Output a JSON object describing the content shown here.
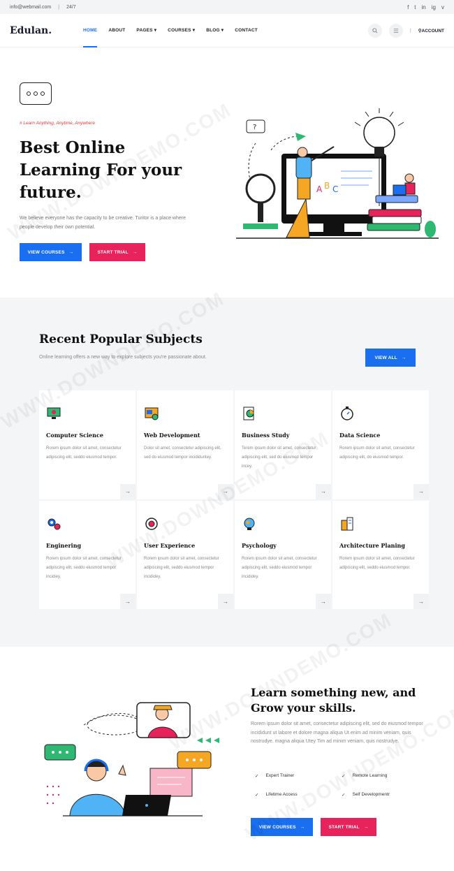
{
  "topbar": {
    "email": "info@webmail.com",
    "hours": "24/7",
    "social": [
      "f",
      "t",
      "in",
      "ig",
      "v"
    ]
  },
  "nav": {
    "logo": "Edulan.",
    "items": [
      "HOME",
      "ABOUT",
      "PAGES ▾",
      "COURSES ▾",
      "BLOG ▾",
      "CONTACT"
    ],
    "account": "ACCOUNT"
  },
  "hero": {
    "tagline": "# Learn Anything, Anytime, Anywhere",
    "title": "Best Online Learning For your future.",
    "desc": "We believe everyone has the capacity to be creative. Turitor is a place where people develop their own potential.",
    "btn_courses": "VIEW COURSES",
    "btn_trial": "START TRIAL"
  },
  "subjects": {
    "title": "Recent Popular Subjects",
    "subtitle": "Online learning offers a new way to explore subjects you're passionate about.",
    "view_all": "VIEW ALL",
    "cards": [
      {
        "title": "Computer Science",
        "desc": "Rorem ipsum dolor sit amet, consectetur adipiscing elit, seddo eiusmod tempor.",
        "icon": "monitor-icon"
      },
      {
        "title": "Web Development",
        "desc": "Dolor sit amet, consectetur adipiscing elit, sed do eiusmod tempor incididuntey.",
        "icon": "web-icon"
      },
      {
        "title": "Business Study",
        "desc": "Terem ipsum dolor sit amet, consectetur adipiscing elit, sed do eiusmod tempor incey.",
        "icon": "chart-icon"
      },
      {
        "title": "Data Science",
        "desc": "Rorem ipsum dolor sit amet, consectetur adipiscing elit, do eiusmod tempor.",
        "icon": "stopwatch-icon"
      },
      {
        "title": "Enginering",
        "desc": "Rorem ipsum dolor sit amet, consectetur adipiscing elit, seddo eiusmod tempor incidiey.",
        "icon": "gears-icon"
      },
      {
        "title": "User Experience",
        "desc": "Rorem ipsum dolor sit amet, consectetur adipiscing elit, seddo eiusmod tempor incididey.",
        "icon": "target-icon"
      },
      {
        "title": "Psychology",
        "desc": "Rorem ipsum dolor sit amet, consectetur adipiscing elit, seddo eiusmod tempor incididey.",
        "icon": "brain-icon"
      },
      {
        "title": "Architecture Planing",
        "desc": "Rorem ipsum dolor sit amet, consectetur adipiscing elit, seddo eiusmod tempor.",
        "icon": "building-icon"
      }
    ]
  },
  "learn": {
    "title": "Learn something new, and Grow your skills.",
    "desc": "Rorem ipsum dolor sit amet, consectetur adipiscing elit, sed do eiusmod tempor incididunt ut labore et dolore magna aliqua Ut enim ad minim veniam, quis nostrudye. magna aliqua Utey Tim ad minim veniam, quis nostrudye.",
    "features": [
      "Expert Trainer",
      "Remote Learning",
      "Lifetime Access",
      "Self Developmentr"
    ],
    "btn_courses": "VIEW COURSES",
    "btn_trial": "START TRIAL"
  },
  "watermark": "WWW.DOWNDEMO.COM",
  "colors": {
    "blue": "#1a6ef0",
    "pink": "#e8225a",
    "dark": "#111111"
  }
}
